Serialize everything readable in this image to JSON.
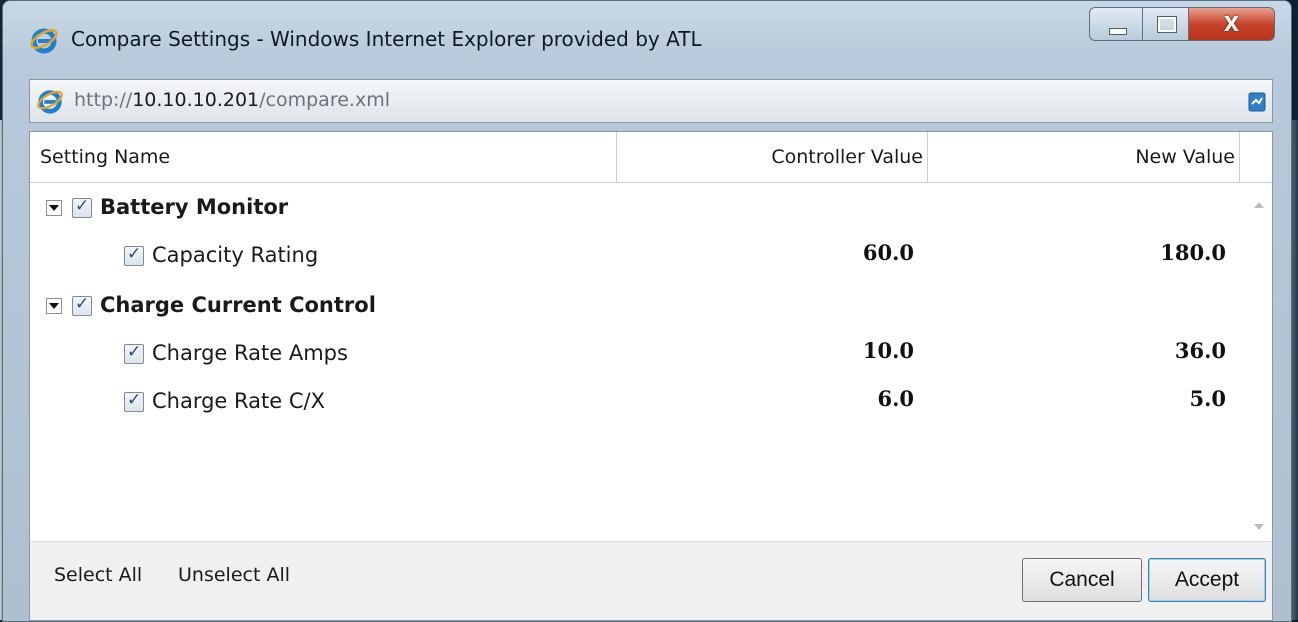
{
  "window": {
    "title": "Compare Settings - Windows Internet Explorer provided by ATL",
    "controls": {
      "minimize": "minimize",
      "maximize": "maximize",
      "close": "X"
    }
  },
  "address": {
    "url_prefix": "http://",
    "url_host": "10.10.10.201",
    "url_path": "/compare.xml"
  },
  "columns": {
    "name": "Setting Name",
    "controller": "Controller Value",
    "new": "New Value"
  },
  "groups": [
    {
      "label": "Battery Monitor",
      "checked": true,
      "expanded": true,
      "items": [
        {
          "label": "Capacity Rating",
          "checked": true,
          "controller": "60.0",
          "new": "180.0"
        }
      ]
    },
    {
      "label": "Charge Current Control",
      "checked": true,
      "expanded": true,
      "items": [
        {
          "label": "Charge Rate Amps",
          "checked": true,
          "controller": "10.0",
          "new": "36.0"
        },
        {
          "label": "Charge Rate C/X",
          "checked": true,
          "controller": "6.0",
          "new": "5.0"
        }
      ]
    }
  ],
  "footer": {
    "select_all": "Select All",
    "unselect_all": "Unselect All",
    "cancel": "Cancel",
    "accept": "Accept"
  },
  "icons": {
    "app": "internet-explorer-icon",
    "page": "internet-explorer-icon",
    "compat": "compatibility-view-icon"
  }
}
